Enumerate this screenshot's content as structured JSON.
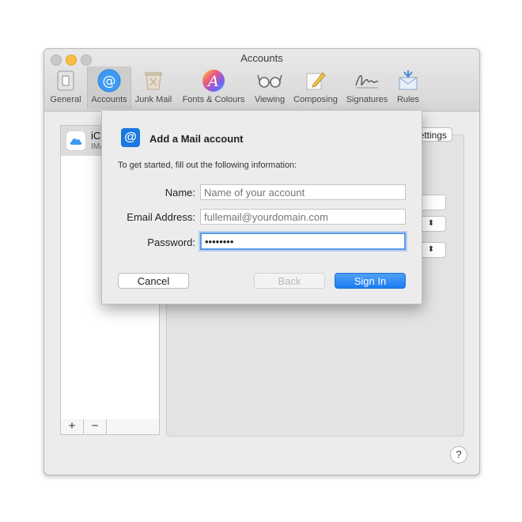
{
  "window": {
    "title": "Accounts"
  },
  "toolbar": {
    "items": [
      {
        "label": "General",
        "icon": "switch-icon"
      },
      {
        "label": "Accounts",
        "icon": "at-icon",
        "active": true
      },
      {
        "label": "Junk Mail",
        "icon": "trash-icon"
      },
      {
        "label": "Fonts & Colours",
        "icon": "fonts-colours-icon"
      },
      {
        "label": "Viewing",
        "icon": "glasses-icon"
      },
      {
        "label": "Composing",
        "icon": "pencil-icon"
      },
      {
        "label": "Signatures",
        "icon": "signature-icon"
      },
      {
        "label": "Rules",
        "icon": "envelope-icon"
      }
    ]
  },
  "accounts_list": {
    "item_name": "iCl",
    "item_subtitle": "IMA"
  },
  "list_controls": {
    "add": "+",
    "remove": "−"
  },
  "detail": {
    "settings_button": "Settings"
  },
  "help": {
    "label": "?"
  },
  "sheet": {
    "title": "Add a Mail account",
    "intro": "To get started, fill out the following information:",
    "fields": {
      "name_label": "Name:",
      "name_placeholder": "Name of your account",
      "email_label": "Email Address:",
      "email_placeholder": "fullemail@yourdomain.com",
      "password_label": "Password:",
      "password_value": "password"
    },
    "buttons": {
      "cancel": "Cancel",
      "back": "Back",
      "sign_in": "Sign In"
    }
  },
  "colors": {
    "accent": "#1b7cf2",
    "focus_ring": "#5b9bea",
    "minimize": "#fdbd40"
  }
}
